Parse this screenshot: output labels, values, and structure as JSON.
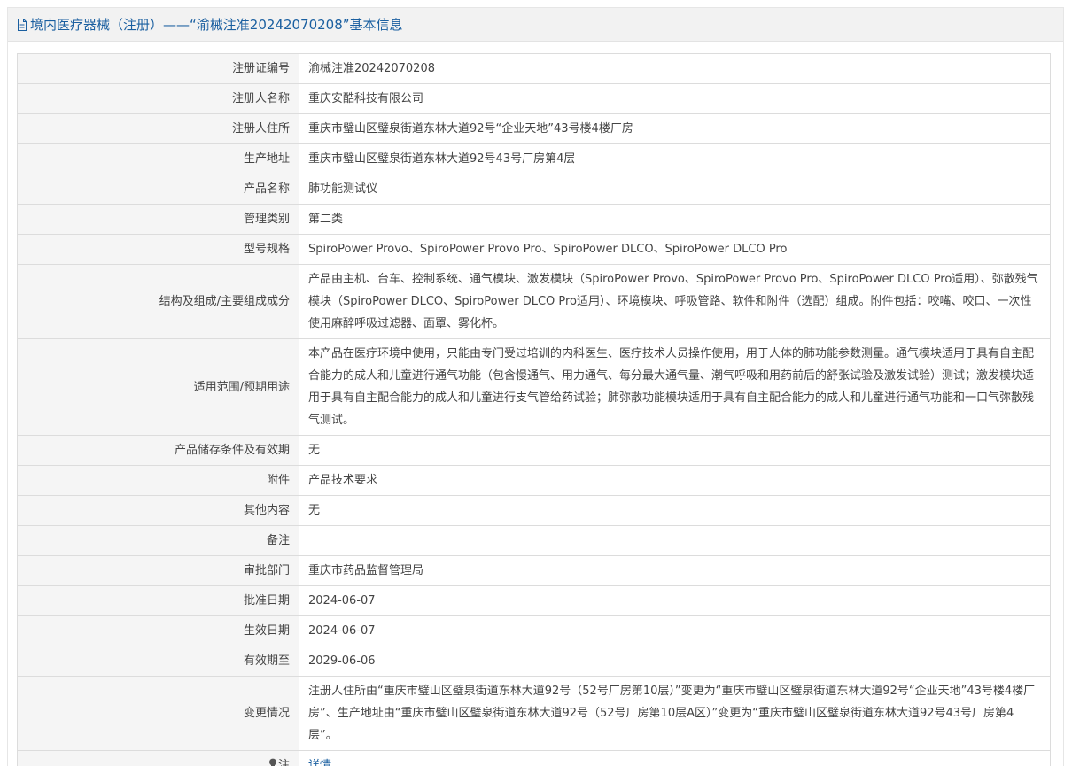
{
  "header": {
    "title": "境内医疗器械（注册）——“渝械注准20242070208”基本信息",
    "icon": "document-icon"
  },
  "rows": [
    {
      "label": "注册证编号",
      "value": "渝械注准20242070208"
    },
    {
      "label": "注册人名称",
      "value": "重庆安酷科技有限公司"
    },
    {
      "label": "注册人住所",
      "value": "重庆市璧山区璧泉街道东林大道92号“企业天地”43号楼4楼厂房"
    },
    {
      "label": "生产地址",
      "value": "重庆市璧山区璧泉街道东林大道92号43号厂房第4层"
    },
    {
      "label": "产品名称",
      "value": "肺功能测试仪"
    },
    {
      "label": "管理类别",
      "value": "第二类"
    },
    {
      "label": "型号规格",
      "value": "SpiroPower Provo、SpiroPower Provo Pro、SpiroPower DLCO、SpiroPower DLCO Pro"
    },
    {
      "label": "结构及组成/主要组成成分",
      "value": "产品由主机、台车、控制系统、通气模块、激发模块（SpiroPower Provo、SpiroPower Provo Pro、SpiroPower DLCO Pro适用）、弥散残气模块（SpiroPower DLCO、SpiroPower DLCO Pro适用）、环境模块、呼吸管路、软件和附件（选配）组成。附件包括：咬嘴、咬口、一次性使用麻醉呼吸过滤器、面罩、雾化杯。"
    },
    {
      "label": "适用范围/预期用途",
      "value": "本产品在医疗环境中使用，只能由专门受过培训的内科医生、医疗技术人员操作使用，用于人体的肺功能参数测量。通气模块适用于具有自主配合能力的成人和儿童进行通气功能（包含慢通气、用力通气、每分最大通气量、潮气呼吸和用药前后的舒张试验及激发试验）测试；激发模块适用于具有自主配合能力的成人和儿童进行支气管给药试验；肺弥散功能模块适用于具有自主配合能力的成人和儿童进行通气功能和一口气弥散残气测试。"
    },
    {
      "label": "产品储存条件及有效期",
      "value": "无"
    },
    {
      "label": "附件",
      "value": "产品技术要求"
    },
    {
      "label": "其他内容",
      "value": "无"
    },
    {
      "label": "备注",
      "value": ""
    },
    {
      "label": "审批部门",
      "value": "重庆市药品监督管理局"
    },
    {
      "label": "批准日期",
      "value": "2024-06-07"
    },
    {
      "label": "生效日期",
      "value": "2024-06-07"
    },
    {
      "label": "有效期至",
      "value": "2029-06-06"
    },
    {
      "label": "变更情况",
      "value": "注册人住所由“重庆市璧山区璧泉街道东林大道92号（52号厂房第10层）”变更为“重庆市璧山区璧泉街道东林大道92号“企业天地”43号楼4楼厂房”、生产地址由“重庆市璧山区璧泉街道东林大道92号（52号厂房第10层A区）”变更为“重庆市璧山区璧泉街道东林大道92号43号厂房第4层”。"
    }
  ],
  "note": {
    "label": "注",
    "icon": "lightbulb-icon",
    "link_text": "详情"
  },
  "colors": {
    "title": "#1a5fa0",
    "link": "#1a5fa0",
    "label_bg": "#f5f5f5",
    "border": "#dcdcdc",
    "header_bg": "#f2f2f2"
  }
}
